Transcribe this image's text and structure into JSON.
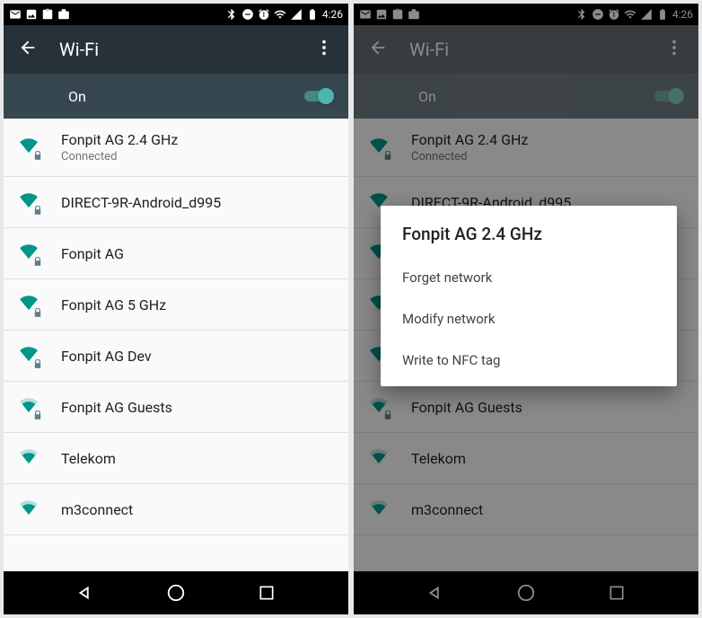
{
  "status": {
    "time": "4:26"
  },
  "header": {
    "title": "Wi-Fi"
  },
  "toggle": {
    "label": "On"
  },
  "networks": [
    {
      "name": "Fonpit AG 2.4 GHz",
      "status": "Connected",
      "locked": true,
      "strength": "full"
    },
    {
      "name": "DIRECT-9R-Android_d995",
      "locked": true,
      "strength": "full"
    },
    {
      "name": "Fonpit AG",
      "locked": true,
      "strength": "full"
    },
    {
      "name": "Fonpit AG 5 GHz",
      "locked": true,
      "strength": "full"
    },
    {
      "name": "Fonpit AG Dev",
      "locked": true,
      "strength": "full"
    },
    {
      "name": "Fonpit AG Guests",
      "locked": true,
      "strength": "med"
    },
    {
      "name": "Telekom",
      "locked": false,
      "strength": "med"
    },
    {
      "name": "m3connect",
      "locked": false,
      "strength": "med"
    }
  ],
  "dialog": {
    "title": "Fonpit AG 2.4 GHz",
    "items": [
      "Forget network",
      "Modify network",
      "Write to NFC tag"
    ]
  }
}
